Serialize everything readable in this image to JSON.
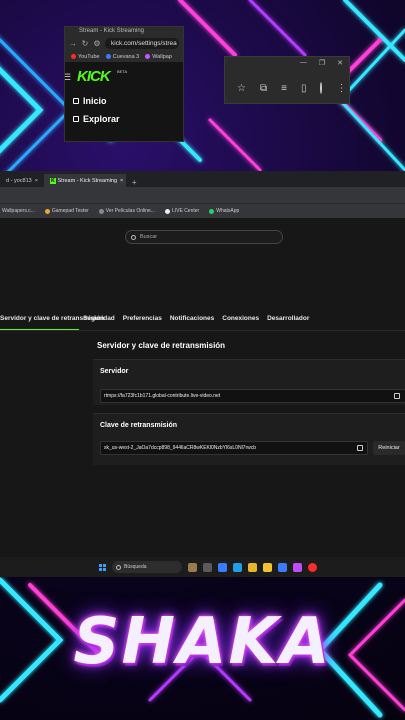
{
  "mini_browser": {
    "tab_title": "Stream - Kick Streaming",
    "url": "kick.com/settings/strea",
    "bookmarks": [
      "YouTube",
      "Cuevana 3",
      "Wallpap"
    ],
    "logo": "KICK",
    "logo_badge": "BETA",
    "nav": [
      "Inicio",
      "Explorar"
    ]
  },
  "browser": {
    "tabs": [
      {
        "label": "d - yoc813"
      },
      {
        "label": "Stream - Kick Streaming"
      }
    ],
    "bookmarks": [
      "Wallpapers.c...",
      "Gamepad Tester",
      "Ver Películas Online...",
      "LIVE Center",
      "WhatsApp"
    ]
  },
  "page": {
    "search_placeholder": "Buscar",
    "settings_tabs": [
      "Servidor y clave de retransmisión",
      "Seguridad",
      "Preferencias",
      "Notificaciones",
      "Conexiones",
      "Desarrollador"
    ],
    "section_title": "Servidor y clave de retransmisión",
    "server": {
      "title": "Servidor",
      "value": "rtmps://fa723fc1b171.global-contribute.live-video.net"
    },
    "stream_key": {
      "title": "Clave de retransmisión",
      "value": "sk_us-west-2_JaOa7dccp898_944lIaCR8wKEKl0NzbYl6sL0Nl7rwcb",
      "reset_label": "Reiniciar"
    }
  },
  "taskbar": {
    "search_label": "Búsqueda"
  },
  "banner": {
    "title": "SHAKA"
  },
  "colors": {
    "kick_green": "#53fc18",
    "neon_pink": "#ff5cf0",
    "neon_purple": "#7b2dff"
  }
}
